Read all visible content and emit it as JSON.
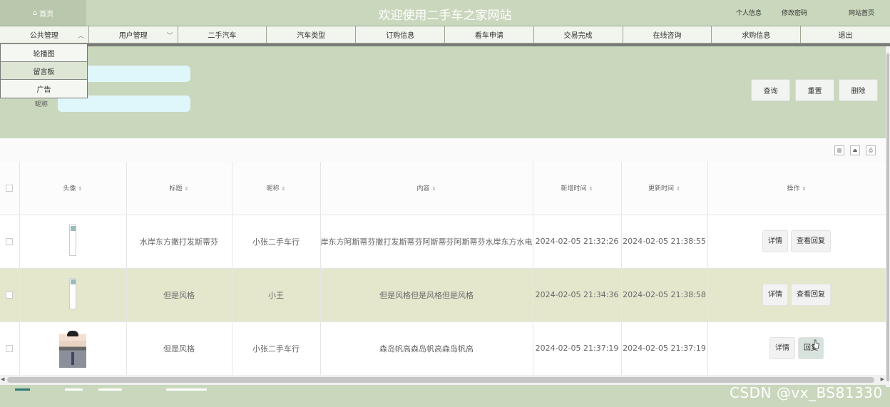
{
  "header": {
    "home_label": "首页",
    "title": "欢迎使用二手车之家网站",
    "links": {
      "profile": "个人信息",
      "change_password": "修改密码",
      "site_home": "网站首页"
    }
  },
  "nav": {
    "items": [
      {
        "label": "公共管理",
        "has_dropdown": true
      },
      {
        "label": "用户管理",
        "has_dropdown": true
      },
      {
        "label": "二手汽车"
      },
      {
        "label": "汽车类型"
      },
      {
        "label": "订购信息"
      },
      {
        "label": "看车申请"
      },
      {
        "label": "交易完成"
      },
      {
        "label": "在线咨询"
      },
      {
        "label": "求购信息"
      },
      {
        "label": "退出"
      }
    ],
    "dropdown": [
      "轮播图",
      "留言板",
      "广告"
    ]
  },
  "search": {
    "nickname_label": "昵称",
    "title_value": "",
    "nickname_value": "",
    "buttons": {
      "query": "查询",
      "reset": "重置",
      "delete": "删除"
    }
  },
  "table": {
    "columns": [
      "头像",
      "标题",
      "昵称",
      "内容",
      "新增时间",
      "更新时间",
      "操作"
    ],
    "rows": [
      {
        "avatar": "broken-image",
        "title": "水岸东方撒打发斯蒂芬",
        "nickname": "小张二手车行",
        "content": "岸东方阿斯蒂芬撒打发斯蒂芬阿斯蒂芬阿斯蒂芬水岸东方水电",
        "created": "2024-02-05 21:32:26",
        "updated": "2024-02-05 21:38:55",
        "actions": [
          "详情",
          "查看回复"
        ]
      },
      {
        "avatar": "broken-image",
        "title": "但是风格",
        "nickname": "小王",
        "content": "但是风格但是风格但是风格",
        "created": "2024-02-05 21:34:36",
        "updated": "2024-02-05 21:38:58",
        "actions": [
          "详情",
          "查看回复"
        ]
      },
      {
        "avatar": "person-photo",
        "title": "但是风格",
        "nickname": "小张二手车行",
        "content": "森岛帆高森岛帆高森岛帆高",
        "created": "2024-02-05 21:37:19",
        "updated": "2024-02-05 21:37:19",
        "actions": [
          "详情",
          "回复"
        ]
      }
    ]
  },
  "watermark": "CSDN @vx_BS81330",
  "colors": {
    "theme": "#c9d7bc",
    "highlight_row": "#e5e7cd",
    "input_bg": "#dff6fb",
    "pager_active": "#2b7a78"
  }
}
